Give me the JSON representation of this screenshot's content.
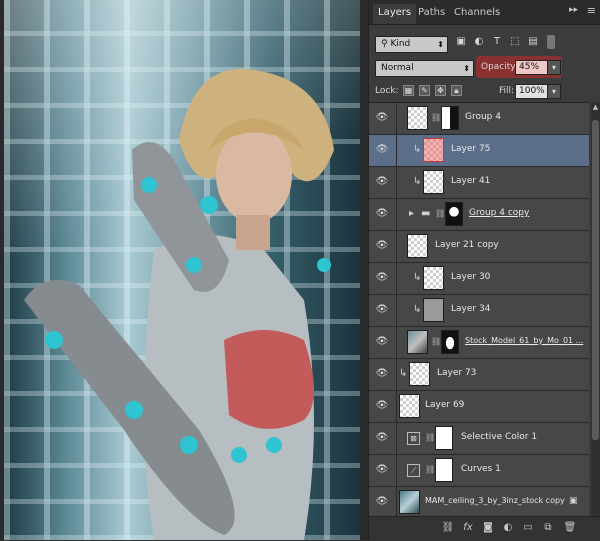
{
  "panel": {
    "tabs": [
      {
        "label": "Layers"
      },
      {
        "label": "Paths"
      },
      {
        "label": "Channels"
      }
    ],
    "menu_icon": "collapse-icon",
    "filter": {
      "kind": "Kind"
    },
    "blend_mode": "Normal",
    "opacity_label": "Opacity:",
    "opacity_value": "45%",
    "lock_label": "Lock:",
    "fill_label": "Fill:",
    "fill_value": "100%",
    "highlight_color": "#d03030",
    "selected_color": "#5b6e8a"
  },
  "layers": [
    {
      "name": "Group 4",
      "type": "layer-mask",
      "visible": true
    },
    {
      "name": "Layer 75",
      "type": "clipped",
      "selected": true,
      "visible": true
    },
    {
      "name": "Layer 41",
      "type": "clipped",
      "visible": true
    },
    {
      "name": "Group 4 copy",
      "type": "group",
      "visible": true
    },
    {
      "name": "Layer 21 copy",
      "type": "layer",
      "visible": true
    },
    {
      "name": "Layer 30",
      "type": "clipped",
      "visible": true
    },
    {
      "name": "Layer 34",
      "type": "clipped",
      "visible": true
    },
    {
      "name": "Stock_Model_61_by_Mo_01 ...",
      "type": "layer-mask",
      "visible": true
    },
    {
      "name": "Layer 73",
      "type": "clipped",
      "visible": true
    },
    {
      "name": "Layer 69",
      "type": "layer",
      "visible": true
    },
    {
      "name": "Selective Color 1",
      "type": "adjustment",
      "visible": true
    },
    {
      "name": "Curves 1",
      "type": "adjustment",
      "visible": true
    },
    {
      "name": "MAM_ceiling_3_by_3inz_stock copy",
      "type": "smart",
      "visible": true
    }
  ],
  "bottom_icons": [
    "link-layers-icon",
    "fx-icon",
    "add-mask-icon",
    "adjustment-layer-icon",
    "new-group-icon",
    "new-layer-icon",
    "trash-icon"
  ]
}
